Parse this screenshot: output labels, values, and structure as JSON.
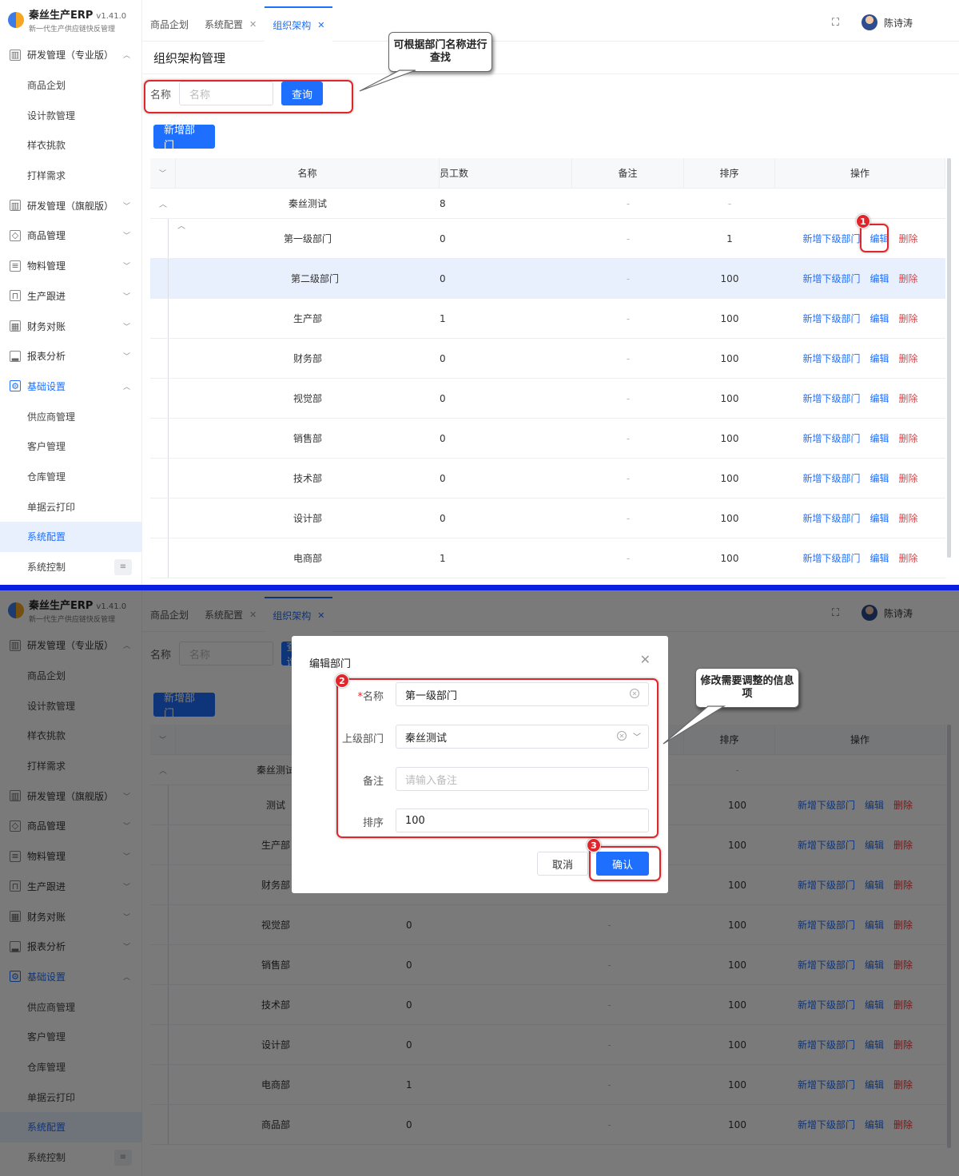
{
  "app": {
    "name": "秦丝生产ERP",
    "version": "v1.41.0",
    "slogan": "新一代生产供应链快反管理"
  },
  "sidebar": {
    "items": [
      {
        "type": "group",
        "label": "研发管理（专业版）",
        "icon": "book-icon",
        "chevron": "up"
      },
      {
        "type": "sub",
        "label": "商品企划"
      },
      {
        "type": "sub",
        "label": "设计款管理"
      },
      {
        "type": "sub",
        "label": "样衣挑款"
      },
      {
        "type": "sub",
        "label": "打样需求"
      },
      {
        "type": "group",
        "label": "研发管理（旗舰版）",
        "icon": "book-icon",
        "chevron": "down"
      },
      {
        "type": "group",
        "label": "商品管理",
        "icon": "shirt-icon",
        "chevron": "down"
      },
      {
        "type": "group",
        "label": "物料管理",
        "icon": "document-icon",
        "chevron": "down"
      },
      {
        "type": "group",
        "label": "生产跟进",
        "icon": "paint-roller-icon",
        "chevron": "down"
      },
      {
        "type": "group",
        "label": "财务对账",
        "icon": "grid-icon",
        "chevron": "down"
      },
      {
        "type": "group",
        "label": "报表分析",
        "icon": "bar-chart-icon",
        "chevron": "down"
      },
      {
        "type": "group",
        "label": "基础设置",
        "icon": "gear-icon",
        "chevron": "up",
        "active": true
      },
      {
        "type": "sub",
        "label": "供应商管理"
      },
      {
        "type": "sub",
        "label": "客户管理"
      },
      {
        "type": "sub",
        "label": "仓库管理"
      },
      {
        "type": "sub",
        "label": "单据云打印"
      },
      {
        "type": "sub",
        "label": "系统配置",
        "selected": true
      },
      {
        "type": "sub",
        "label": "系统控制"
      }
    ]
  },
  "tabs": [
    {
      "label": "商品企划",
      "closable": false
    },
    {
      "label": "系统配置",
      "closable": true
    },
    {
      "label": "组织架构",
      "closable": true,
      "active": true
    }
  ],
  "user": {
    "name": "陈诗涛"
  },
  "page": {
    "title": "组织架构管理",
    "search": {
      "label": "名称",
      "placeholder": "名称",
      "button": "查询"
    },
    "add_button": "新增部门",
    "columns": [
      "名称",
      "员工数",
      "备注",
      "排序",
      "操作"
    ],
    "actions": {
      "add_sub": "新增下级部门",
      "edit": "编辑",
      "delete": "删除"
    }
  },
  "table1_rows": [
    {
      "name": "秦丝测试",
      "count": "8",
      "remark": "-",
      "order": "-",
      "level": 0,
      "ops": false
    },
    {
      "name": "第一级部门",
      "count": "0",
      "remark": "-",
      "order": "1",
      "level": 1,
      "ops": true
    },
    {
      "name": "第二级部门",
      "count": "0",
      "remark": "-",
      "order": "100",
      "level": 2,
      "ops": true,
      "highlight": true
    },
    {
      "name": "生产部",
      "count": "1",
      "remark": "-",
      "order": "100",
      "level": 1,
      "ops": true
    },
    {
      "name": "财务部",
      "count": "0",
      "remark": "-",
      "order": "100",
      "level": 1,
      "ops": true
    },
    {
      "name": "视觉部",
      "count": "0",
      "remark": "-",
      "order": "100",
      "level": 1,
      "ops": true
    },
    {
      "name": "销售部",
      "count": "0",
      "remark": "-",
      "order": "100",
      "level": 1,
      "ops": true
    },
    {
      "name": "技术部",
      "count": "0",
      "remark": "-",
      "order": "100",
      "level": 1,
      "ops": true
    },
    {
      "name": "设计部",
      "count": "0",
      "remark": "-",
      "order": "100",
      "level": 1,
      "ops": true
    },
    {
      "name": "电商部",
      "count": "1",
      "remark": "-",
      "order": "100",
      "level": 1,
      "ops": true
    }
  ],
  "table2_rows": [
    {
      "name": "秦丝测试",
      "count": "",
      "remark": "",
      "order": "-",
      "level": 0,
      "ops": false
    },
    {
      "name": "测试",
      "count": "",
      "remark": "",
      "order": "100",
      "level": 1,
      "ops": true
    },
    {
      "name": "生产部",
      "count": "",
      "remark": "",
      "order": "100",
      "level": 1,
      "ops": true
    },
    {
      "name": "财务部",
      "count": "",
      "remark": "",
      "order": "100",
      "level": 1,
      "ops": true
    },
    {
      "name": "视觉部",
      "count": "0",
      "remark": "-",
      "order": "100",
      "level": 1,
      "ops": true
    },
    {
      "name": "销售部",
      "count": "0",
      "remark": "-",
      "order": "100",
      "level": 1,
      "ops": true
    },
    {
      "name": "技术部",
      "count": "0",
      "remark": "-",
      "order": "100",
      "level": 1,
      "ops": true
    },
    {
      "name": "设计部",
      "count": "0",
      "remark": "-",
      "order": "100",
      "level": 1,
      "ops": true
    },
    {
      "name": "电商部",
      "count": "1",
      "remark": "-",
      "order": "100",
      "level": 1,
      "ops": true
    },
    {
      "name": "商品部",
      "count": "0",
      "remark": "-",
      "order": "100",
      "level": 1,
      "ops": true
    }
  ],
  "modal": {
    "title": "编辑部门",
    "fields": [
      {
        "label": "名称",
        "required": true,
        "value": "第一级部门",
        "placeholder": "",
        "clear": true,
        "arrow": false
      },
      {
        "label": "上级部门",
        "required": false,
        "value": "秦丝测试",
        "placeholder": "",
        "clear": true,
        "arrow": true
      },
      {
        "label": "备注",
        "required": false,
        "value": "",
        "placeholder": "请输入备注",
        "clear": false,
        "arrow": false
      },
      {
        "label": "排序",
        "required": false,
        "value": "100",
        "placeholder": "",
        "clear": false,
        "arrow": false
      }
    ],
    "cancel": "取消",
    "confirm": "确认"
  },
  "annotations": {
    "search_tip": "可根据部门名称进行查找",
    "edit_tip": "修改需要调整的信息项",
    "step1": "1",
    "step2": "2",
    "step3": "3"
  },
  "colors": {
    "primary": "#1f6fff",
    "danger": "#f5393e",
    "annotation": "#e0262b",
    "divider": "#0b1fe0"
  }
}
